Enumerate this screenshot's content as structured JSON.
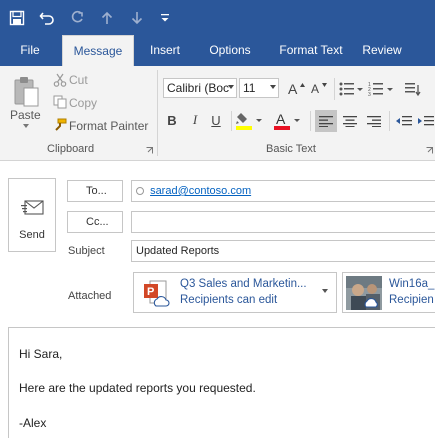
{
  "quick_access": {
    "icons": [
      "save-icon",
      "undo-icon",
      "redo-icon",
      "up-arrow-icon",
      "down-arrow-icon",
      "customize-dropdown-icon"
    ]
  },
  "tabs": [
    "File",
    "Message",
    "Insert",
    "Options",
    "Format Text",
    "Review"
  ],
  "active_tab": "Message",
  "ribbon": {
    "clipboard": {
      "paste_label": "Paste",
      "cut_label": "Cut",
      "copy_label": "Copy",
      "format_painter_label": "Format Painter",
      "group_label": "Clipboard"
    },
    "basic_text": {
      "font_name": "Calibri (Boc",
      "font_size": "11",
      "group_label": "Basic Text"
    }
  },
  "compose": {
    "send_label": "Send",
    "to_label": "To...",
    "cc_label": "Cc...",
    "to_value": "sarad@contoso.com",
    "cc_value": "",
    "subject_label": "Subject",
    "subject_value": "Updated Reports",
    "attached_label": "Attached",
    "attachments": [
      {
        "name": "Q3 Sales and Marketin...",
        "permission": "Recipients can edit"
      },
      {
        "name": "Win16a_",
        "permission": "Recipien"
      }
    ],
    "body_lines": [
      "Hi Sara,",
      "Here are the updated reports you requested.",
      "-Alex"
    ]
  },
  "colors": {
    "brand": "#2b579a",
    "ribbon_bg": "#f3f3f3",
    "font_color": "#e81123",
    "highlight": "#ffff00",
    "link": "#0563c1",
    "powerpoint": "#d24726"
  }
}
